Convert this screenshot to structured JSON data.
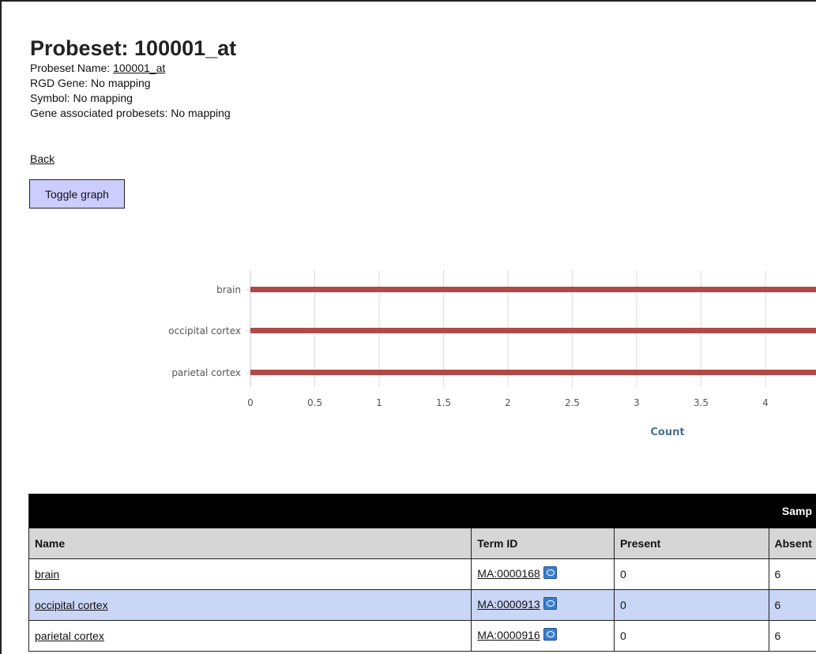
{
  "header": {
    "title": "Probeset: 100001_at",
    "probeset_name_label": "Probeset Name: ",
    "probeset_name_value": "100001_at",
    "rgd_gene": "RGD Gene: No mapping",
    "symbol": "Symbol: No mapping",
    "gene_probesets": "Gene associated probesets: No mapping"
  },
  "nav": {
    "back_label": "Back",
    "toggle_label": "Toggle graph"
  },
  "chart_data": {
    "type": "bar",
    "orientation": "horizontal",
    "categories": [
      "brain",
      "occipital cortex",
      "parietal cortex"
    ],
    "series": [
      {
        "values": [
          6,
          6,
          6
        ]
      }
    ],
    "xlabel": "Count",
    "xticks": [
      "0",
      "0.5",
      "1",
      "1.5",
      "2",
      "2.5",
      "3",
      "3.5",
      "4"
    ],
    "xlim": [
      0,
      6
    ],
    "grid": true,
    "bar_color": "#b04a4a"
  },
  "table": {
    "banner": "Samp",
    "columns": [
      "Name",
      "Term ID",
      "Present",
      "Absent"
    ],
    "rows": [
      {
        "name": "brain",
        "term_id": "MA:0000168",
        "present": "0",
        "absent": "6"
      },
      {
        "name": "occipital cortex",
        "term_id": "MA:0000913",
        "present": "0",
        "absent": "6"
      },
      {
        "name": "parietal cortex",
        "term_id": "MA:0000916",
        "present": "0",
        "absent": "6"
      }
    ]
  },
  "colors": {
    "button_bg": "#ccccff",
    "row_highlight": "#c9d6f5",
    "banner_bg": "#000000",
    "header_bg": "#d6d6d6"
  }
}
